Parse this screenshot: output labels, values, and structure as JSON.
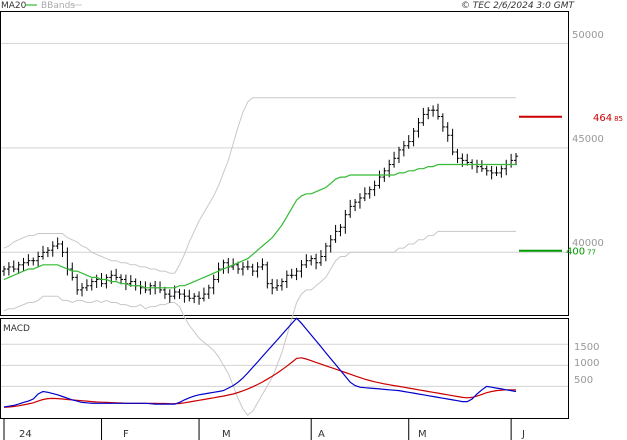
{
  "header": {
    "legend_ma": "MA20",
    "legend_bb": "BBands",
    "copyright": "© TEC 2/6/2024 3:0 GMT"
  },
  "colors": {
    "ma": "#33bb33",
    "bands": "#c8c8c8",
    "candle": "#000000",
    "resistance": "#cc0000",
    "support": "#009900",
    "macd": "#0000cc",
    "signal": "#cc0000",
    "grid": "#d3d3d3"
  },
  "chart_data": [
    {
      "type": "ohlc",
      "title": "",
      "ylim": [
        370,
        515
      ],
      "y_ticks": [
        {
          "value": 400,
          "label": "40000"
        },
        {
          "value": 450,
          "label": "45000"
        },
        {
          "value": 500,
          "label": "50000"
        }
      ],
      "x_labels": [
        "24",
        "F",
        "M",
        "A",
        "M",
        "J"
      ],
      "x_label_positions": [
        0,
        20,
        40,
        63,
        83,
        104
      ],
      "n_periods": 106,
      "close": [
        392,
        393,
        392,
        394,
        395,
        396,
        396,
        398,
        400,
        401,
        403,
        404,
        400,
        392,
        388,
        382,
        383,
        384,
        386,
        387,
        385,
        388,
        389,
        388,
        387,
        385,
        386,
        384,
        383,
        382,
        384,
        383,
        382,
        380,
        379,
        381,
        380,
        379,
        378,
        379,
        378,
        380,
        383,
        387,
        392,
        395,
        393,
        394,
        392,
        393,
        393,
        391,
        393,
        394,
        385,
        383,
        384,
        386,
        389,
        389,
        391,
        394,
        396,
        397,
        395,
        398,
        403,
        406,
        410,
        412,
        418,
        422,
        424,
        426,
        428,
        430,
        432,
        436,
        439,
        442,
        445,
        449,
        451,
        453,
        458,
        462,
        466,
        468,
        468,
        465,
        460,
        456,
        448,
        445,
        444,
        443,
        442,
        441,
        440,
        439,
        438,
        438,
        440,
        442,
        444,
        446
      ],
      "ma20": [
        387,
        388,
        389,
        390,
        391,
        392,
        392,
        393,
        394,
        394,
        394,
        394,
        393,
        392,
        391,
        391,
        390,
        389,
        388,
        388,
        387,
        387,
        386,
        386,
        385,
        385,
        384,
        384,
        384,
        383,
        383,
        383,
        383,
        383,
        383,
        383,
        384,
        384,
        385,
        386,
        387,
        388,
        389,
        390,
        391,
        392,
        393,
        394,
        395,
        396,
        397,
        399,
        401,
        403,
        405,
        407,
        410,
        413,
        417,
        421,
        425,
        427,
        428,
        428,
        429,
        430,
        431,
        433,
        435,
        436,
        436,
        437,
        437,
        437,
        437,
        437,
        437,
        437,
        437,
        437,
        437,
        438,
        438,
        439,
        439,
        440,
        440,
        441,
        441,
        442,
        442,
        442,
        442,
        442,
        442,
        442,
        442,
        442,
        442,
        442,
        442,
        442,
        442,
        442,
        442,
        442
      ],
      "bb_upper": [
        402,
        403,
        405,
        406,
        407,
        408,
        408,
        409,
        409,
        409,
        409,
        409,
        409,
        407,
        406,
        405,
        403,
        402,
        400,
        399,
        398,
        397,
        396,
        396,
        395,
        395,
        394,
        394,
        393,
        393,
        392,
        392,
        391,
        391,
        390,
        390,
        394,
        399,
        405,
        410,
        415,
        419,
        423,
        427,
        432,
        438,
        444,
        452,
        460,
        467,
        472,
        474,
        474,
        474,
        474,
        474,
        474,
        474,
        474,
        474,
        474,
        474,
        474,
        474,
        474,
        474,
        474,
        474,
        474,
        474,
        474,
        474,
        474,
        474,
        474,
        474,
        474,
        474,
        474,
        474,
        474,
        474,
        474,
        474,
        474,
        474,
        474,
        474,
        474,
        474,
        474,
        474,
        474,
        474,
        474,
        474,
        474,
        474,
        474,
        474,
        474,
        474,
        474,
        474,
        474,
        474
      ],
      "bb_lower": [
        372,
        373,
        373,
        374,
        375,
        376,
        376,
        377,
        379,
        379,
        379,
        379,
        377,
        377,
        376,
        377,
        377,
        376,
        376,
        377,
        376,
        377,
        376,
        376,
        375,
        375,
        374,
        374,
        375,
        373,
        374,
        374,
        375,
        375,
        376,
        376,
        374,
        369,
        365,
        362,
        359,
        357,
        355,
        353,
        350,
        346,
        342,
        336,
        330,
        325,
        322,
        324,
        328,
        332,
        336,
        340,
        346,
        352,
        360,
        368,
        376,
        380,
        382,
        382,
        384,
        386,
        388,
        392,
        396,
        398,
        398,
        400,
        400,
        400,
        400,
        400,
        400,
        400,
        400,
        400,
        400,
        402,
        402,
        404,
        404,
        406,
        406,
        408,
        408,
        410,
        410,
        410,
        410,
        410,
        410,
        410,
        410,
        410,
        410,
        410,
        410,
        410,
        410,
        410,
        410,
        410
      ],
      "resistance": {
        "value": 464.85,
        "label_main": "464",
        "label_sub": "85"
      },
      "support": {
        "value": 400.77,
        "label_main": "400",
        "label_sub": "77"
      }
    },
    {
      "type": "line",
      "title": "MACD",
      "ylim": [
        -250,
        2100
      ],
      "y_ticks": [
        {
          "value": 500,
          "label": "500"
        },
        {
          "value": 1000,
          "label": "1000"
        },
        {
          "value": 1500,
          "label": "1500"
        }
      ],
      "series": [
        {
          "name": "",
          "values": [
            10,
            30,
            50,
            80,
            120,
            150,
            200,
            320,
            380,
            360,
            330,
            300,
            260,
            220,
            180,
            150,
            120,
            110,
            100,
            100,
            100,
            100,
            100,
            100,
            100,
            100,
            100,
            100,
            100,
            100,
            90,
            80,
            80,
            80,
            80,
            80,
            120,
            180,
            230,
            270,
            300,
            320,
            340,
            360,
            380,
            400,
            460,
            520,
            600,
            700,
            820,
            950,
            1080,
            1210,
            1340,
            1470,
            1600,
            1730,
            1860,
            1990,
            2120,
            2000,
            1860,
            1720,
            1580,
            1440,
            1300,
            1160,
            1020,
            880,
            740,
            600,
            520,
            480,
            470,
            460,
            450,
            440,
            430,
            420,
            410,
            400,
            380,
            360,
            340,
            320,
            300,
            280,
            260,
            240,
            220,
            200,
            180,
            160,
            140,
            140,
            200,
            320,
            420,
            500,
            480,
            460,
            440,
            420,
            400,
            380
          ]
        },
        {
          "name": "",
          "values": [
            5,
            12,
            22,
            40,
            60,
            85,
            110,
            150,
            190,
            210,
            215,
            210,
            200,
            190,
            180,
            170,
            160,
            150,
            140,
            130,
            125,
            120,
            115,
            110,
            105,
            100,
            100,
            100,
            100,
            100,
            100,
            100,
            95,
            95,
            90,
            90,
            95,
            110,
            130,
            150,
            170,
            190,
            210,
            230,
            250,
            270,
            295,
            320,
            355,
            395,
            440,
            490,
            545,
            605,
            670,
            740,
            815,
            895,
            980,
            1070,
            1165,
            1180,
            1150,
            1110,
            1070,
            1030,
            990,
            950,
            910,
            870,
            830,
            790,
            750,
            710,
            670,
            640,
            610,
            585,
            560,
            540,
            520,
            500,
            480,
            460,
            440,
            420,
            400,
            380,
            360,
            340,
            320,
            300,
            280,
            260,
            240,
            230,
            240,
            270,
            310,
            350,
            380,
            400,
            410,
            420,
            420,
            420
          ]
        }
      ]
    }
  ]
}
